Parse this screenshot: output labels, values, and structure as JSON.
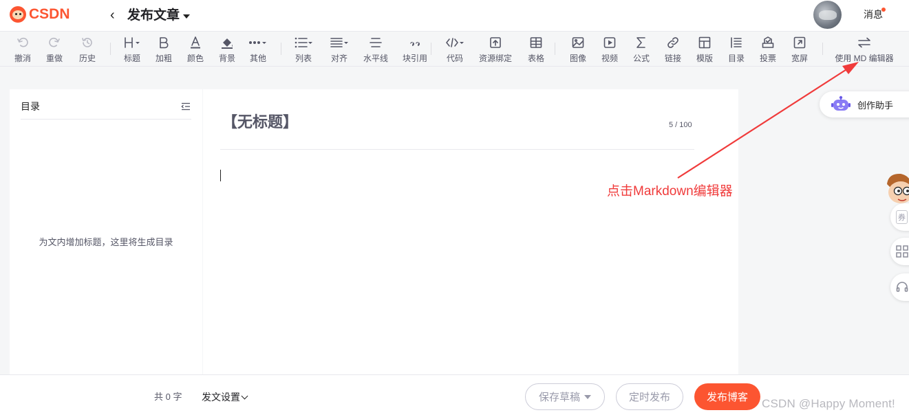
{
  "header": {
    "logo_text": "CSDN",
    "page_title": "发布文章",
    "messages_label": "消息"
  },
  "toolbar": {
    "groups": [
      [
        {
          "label": "撤消",
          "icon": "undo-icon"
        },
        {
          "label": "重做",
          "icon": "redo-icon"
        },
        {
          "label": "历史",
          "icon": "history-icon"
        }
      ],
      [
        {
          "label": "标题",
          "icon": "heading-icon"
        },
        {
          "label": "加粗",
          "icon": "bold-icon"
        },
        {
          "label": "颜色",
          "icon": "font-color-icon"
        },
        {
          "label": "背景",
          "icon": "background-icon"
        },
        {
          "label": "其他",
          "icon": "more-icon"
        }
      ],
      [
        {
          "label": "列表",
          "icon": "list-icon"
        },
        {
          "label": "对齐",
          "icon": "align-icon"
        },
        {
          "label": "水平线",
          "icon": "horizontal-rule-icon"
        },
        {
          "label": "块引用",
          "icon": "quote-icon"
        }
      ],
      [
        {
          "label": "代码",
          "icon": "code-icon"
        },
        {
          "label": "资源绑定",
          "icon": "upload-icon"
        },
        {
          "label": "表格",
          "icon": "table-icon"
        }
      ],
      [
        {
          "label": "图像",
          "icon": "image-icon"
        },
        {
          "label": "视频",
          "icon": "video-icon"
        },
        {
          "label": "公式",
          "icon": "formula-icon"
        },
        {
          "label": "链接",
          "icon": "link-icon"
        },
        {
          "label": "模版",
          "icon": "template-icon"
        },
        {
          "label": "目录",
          "icon": "toc-icon"
        },
        {
          "label": "投票",
          "icon": "vote-icon"
        },
        {
          "label": "宽屏",
          "icon": "widescreen-icon"
        }
      ],
      [
        {
          "label": "使用 MD 编辑器",
          "icon": "switch-editor-icon"
        }
      ]
    ]
  },
  "toc": {
    "title": "目录",
    "empty_text": "为文内增加标题，这里将生成目录"
  },
  "editor": {
    "title_placeholder": "【无标题】",
    "title_count": "5 / 100"
  },
  "assistant": {
    "label": "创作助手"
  },
  "annotation": {
    "text": "点击Markdown编辑器",
    "color": "#f03b3b"
  },
  "side_tools": {
    "coupon_label": "券"
  },
  "footer": {
    "word_count": "共 0 字",
    "settings_label": "发文设置",
    "save_draft_label": "保存草稿",
    "scheduled_label": "定时发布",
    "publish_label": "发布博客"
  },
  "watermark": "CSDN @Happy Moment!",
  "colors": {
    "brand": "#fc5531",
    "text": "#222226",
    "muted": "#555666"
  }
}
